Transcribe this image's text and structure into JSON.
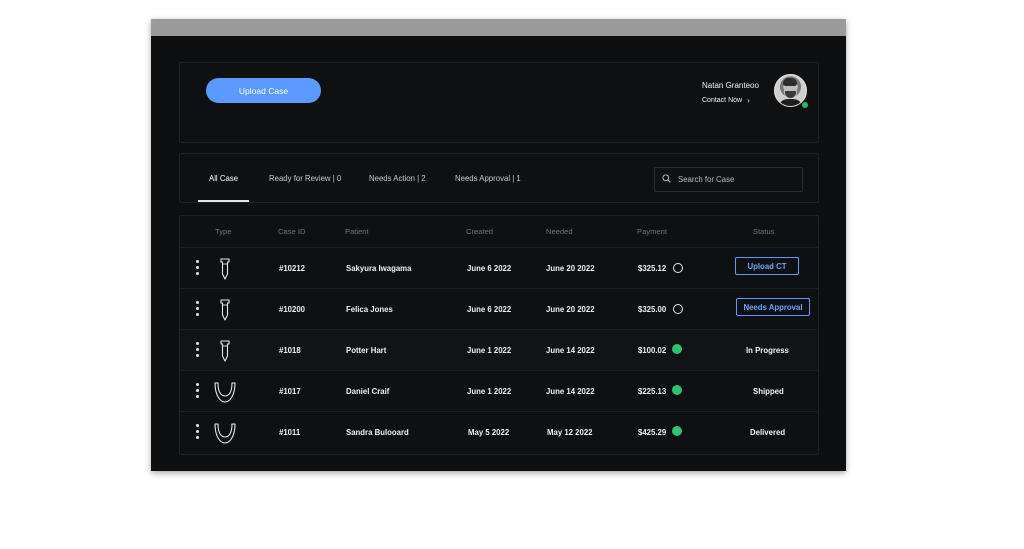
{
  "header": {
    "upload_label": "Upload Case",
    "user_name": "Natan Granteoo",
    "contact_label": "Contact Now",
    "online_color": "#1fbf67"
  },
  "tabs": [
    {
      "label": "All Case",
      "active": true
    },
    {
      "label": "Ready for Review | 0",
      "active": false
    },
    {
      "label": "Needs Action | 2",
      "active": false
    },
    {
      "label": "Needs Approval | 1",
      "active": false
    }
  ],
  "search": {
    "placeholder": "Search for Case",
    "value": ""
  },
  "table": {
    "columns": [
      "Type",
      "Case ID",
      "Patient",
      "Created",
      "Needed",
      "Payment",
      "Status"
    ],
    "rows": [
      {
        "type_icon": "implant-icon",
        "case_id": "#10212",
        "patient": "Sakyura Iwagama",
        "created": "June 6 2022",
        "needed": "June 20 2022",
        "payment": "$325.12",
        "payment_status": "unpaid",
        "status": "Upload CT",
        "status_is_action": true
      },
      {
        "type_icon": "implant-icon",
        "case_id": "#10200",
        "patient": "Felica Jones",
        "created": "June 6 2022",
        "needed": "June 20 2022",
        "payment": "$325.00",
        "payment_status": "unpaid",
        "status": "Needs Approval",
        "status_is_action": true
      },
      {
        "type_icon": "implant-icon",
        "case_id": "#1018",
        "patient": "Potter Hart",
        "created": "June 1 2022",
        "needed": "June 14 2022",
        "payment": "$100.02",
        "payment_status": "paid",
        "status": "In Progress",
        "status_is_action": false
      },
      {
        "type_icon": "arch-icon",
        "case_id": "#1017",
        "patient": "Daniel Craif",
        "created": "June 1 2022",
        "needed": "June 14 2022",
        "payment": "$225.13",
        "payment_status": "paid",
        "status": "Shipped",
        "status_is_action": false
      },
      {
        "type_icon": "arch-icon",
        "case_id": "#1011",
        "patient": "Sandra Bulooard",
        "created": "May 5 2022",
        "needed": "May 12 2022",
        "payment": "$425.29",
        "payment_status": "paid",
        "status": "Delivered",
        "status_is_action": false
      }
    ]
  },
  "colors": {
    "accent": "#5b9bff",
    "paid": "#2ec46f",
    "background": "#0e0f11"
  }
}
